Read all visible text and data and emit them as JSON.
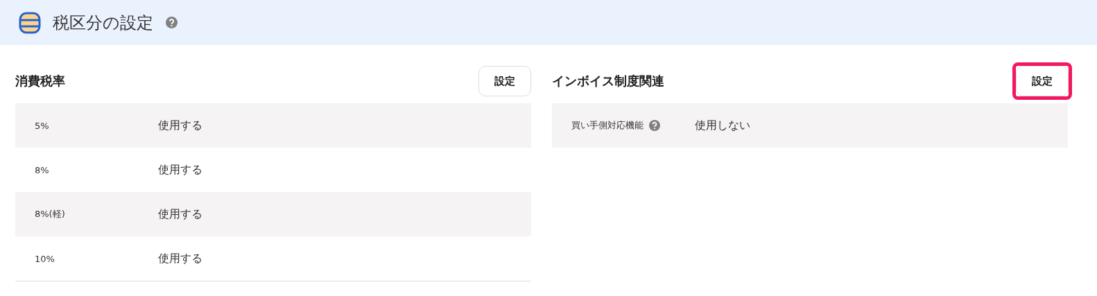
{
  "header": {
    "title": "税区分の設定"
  },
  "sections": [
    {
      "title": "消費税率",
      "button": "設定",
      "highlighted": false,
      "rows": [
        {
          "label": "5%",
          "value": "使用する",
          "help": false
        },
        {
          "label": "8%",
          "value": "使用する",
          "help": false
        },
        {
          "label": "8%(軽)",
          "value": "使用する",
          "help": false
        },
        {
          "label": "10%",
          "value": "使用する",
          "help": false
        }
      ]
    },
    {
      "title": "インボイス制度関連",
      "button": "設定",
      "highlighted": true,
      "rows": [
        {
          "label": "買い手側対応機能",
          "value": "使用しない",
          "help": true
        }
      ]
    }
  ]
}
